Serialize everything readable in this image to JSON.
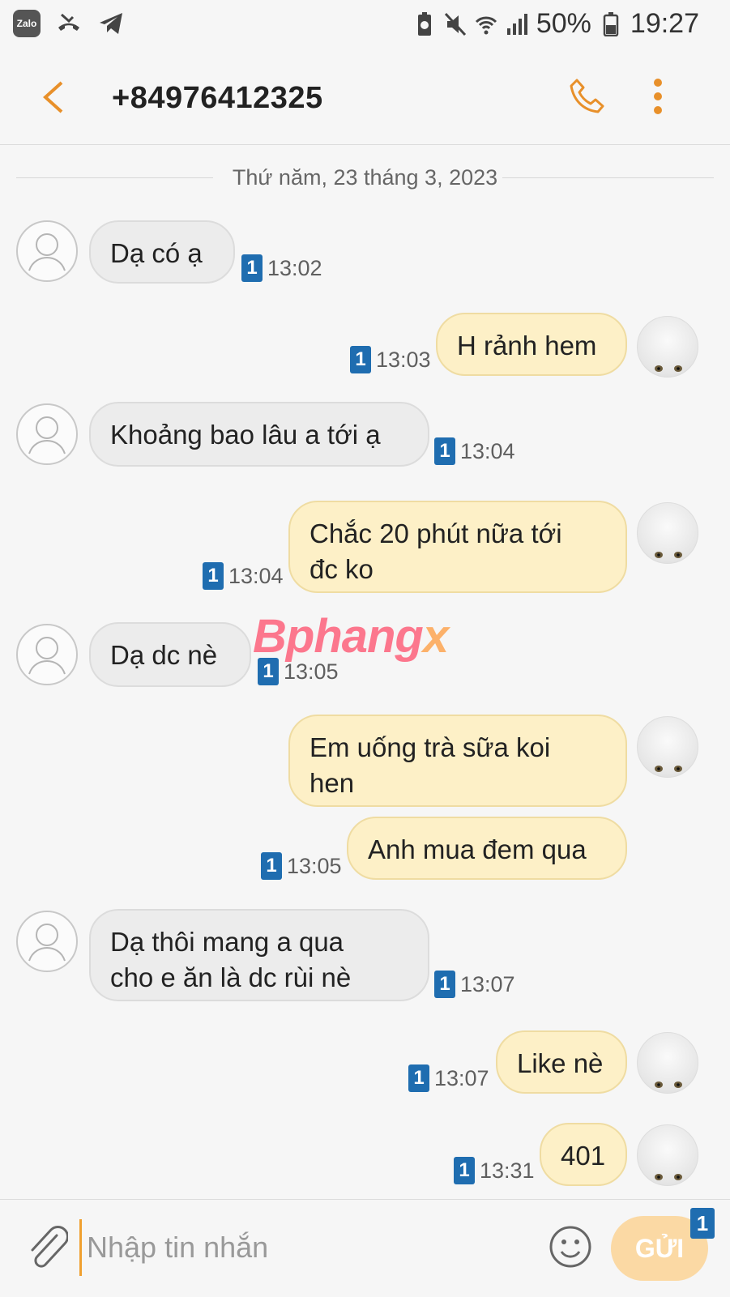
{
  "status_bar": {
    "notif_icons": [
      "zalo-icon",
      "missed-call-icon",
      "telegram-icon"
    ],
    "zalo_label": "Zalo",
    "battery_percent": "50%",
    "time": "19:27"
  },
  "header": {
    "title": "+84976412325",
    "accent_color": "#e8902a"
  },
  "date_separator": "Thứ năm, 23 tháng 3, 2023",
  "messages": [
    {
      "dir": "in",
      "text": "Dạ có ạ",
      "sim": "1",
      "time": "13:02"
    },
    {
      "dir": "out",
      "text": "H rảnh hem",
      "sim": "1",
      "time": "13:03"
    },
    {
      "dir": "in",
      "text": "Khoảng bao lâu a tới ạ",
      "sim": "1",
      "time": "13:04"
    },
    {
      "dir": "out",
      "text": "Chắc 20  phút nữa tới\nđc ko",
      "sim": "1",
      "time": "13:04"
    },
    {
      "dir": "in",
      "text": "Dạ dc nè",
      "sim": "1",
      "time": "13:05"
    },
    {
      "dir": "out",
      "text": "Em uống trà sữa koi\nhen",
      "sim": "",
      "time": ""
    },
    {
      "dir": "out",
      "text": "Anh mua đem qua",
      "sim": "1",
      "time": "13:05"
    },
    {
      "dir": "in",
      "text": "Dạ thôi mang a qua\ncho e ăn là dc rùi nè",
      "sim": "1",
      "time": "13:07"
    },
    {
      "dir": "out",
      "text": "Like nè",
      "sim": "1",
      "time": "13:07"
    },
    {
      "dir": "out",
      "text": "401",
      "sim": "1",
      "time": "13:31"
    }
  ],
  "watermark": {
    "part1": "Bphang",
    "part2": "x"
  },
  "composer": {
    "placeholder": "Nhập tin nhắn",
    "value": "",
    "send_label": "GỬI",
    "send_sim": "1"
  }
}
